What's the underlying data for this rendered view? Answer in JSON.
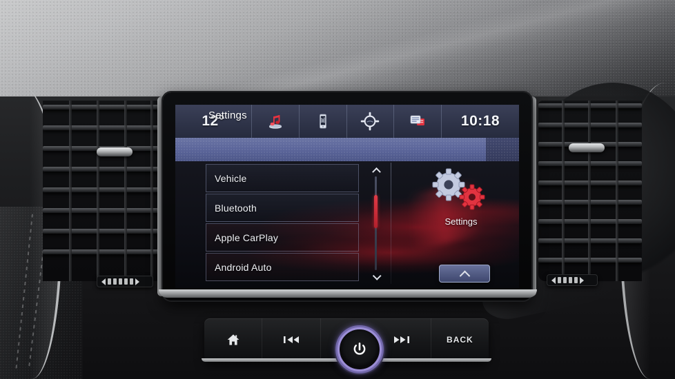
{
  "screen": {
    "statusbar": {
      "temperature": "12°",
      "clock": "10:18",
      "icons": [
        {
          "name": "audio-media-icon",
          "label": "Audio"
        },
        {
          "name": "phone-projection-icon",
          "label": "Phone"
        },
        {
          "name": "navigation-target-icon",
          "label": "Navigation"
        },
        {
          "name": "messages-icon",
          "label": "Messages"
        }
      ]
    },
    "page": {
      "title": "Settings"
    },
    "menu": {
      "items": [
        {
          "label": "Vehicle"
        },
        {
          "label": "Bluetooth"
        },
        {
          "label": "Apple CarPlay"
        },
        {
          "label": "Android Auto"
        }
      ]
    },
    "scrollbar": {
      "up_label": "Scroll up",
      "down_label": "Scroll down",
      "thumb_position_percent": 33
    },
    "right_panel": {
      "app_label": "Settings",
      "up_button_label": "Up"
    }
  },
  "controls": {
    "buttons": [
      {
        "name": "home-button",
        "label": ""
      },
      {
        "name": "previous-track-button",
        "label": ""
      },
      {
        "name": "next-track-button",
        "label": ""
      },
      {
        "name": "back-button",
        "label": "BACK"
      }
    ],
    "power_knob": {
      "label": "Power / Volume"
    }
  },
  "colors": {
    "accent_red": "#d4232f",
    "header_blue": "#5b659a",
    "status_blue": "#2f3449",
    "knob_ring": "#af a0eb",
    "text_white": "#f2f4f8"
  }
}
